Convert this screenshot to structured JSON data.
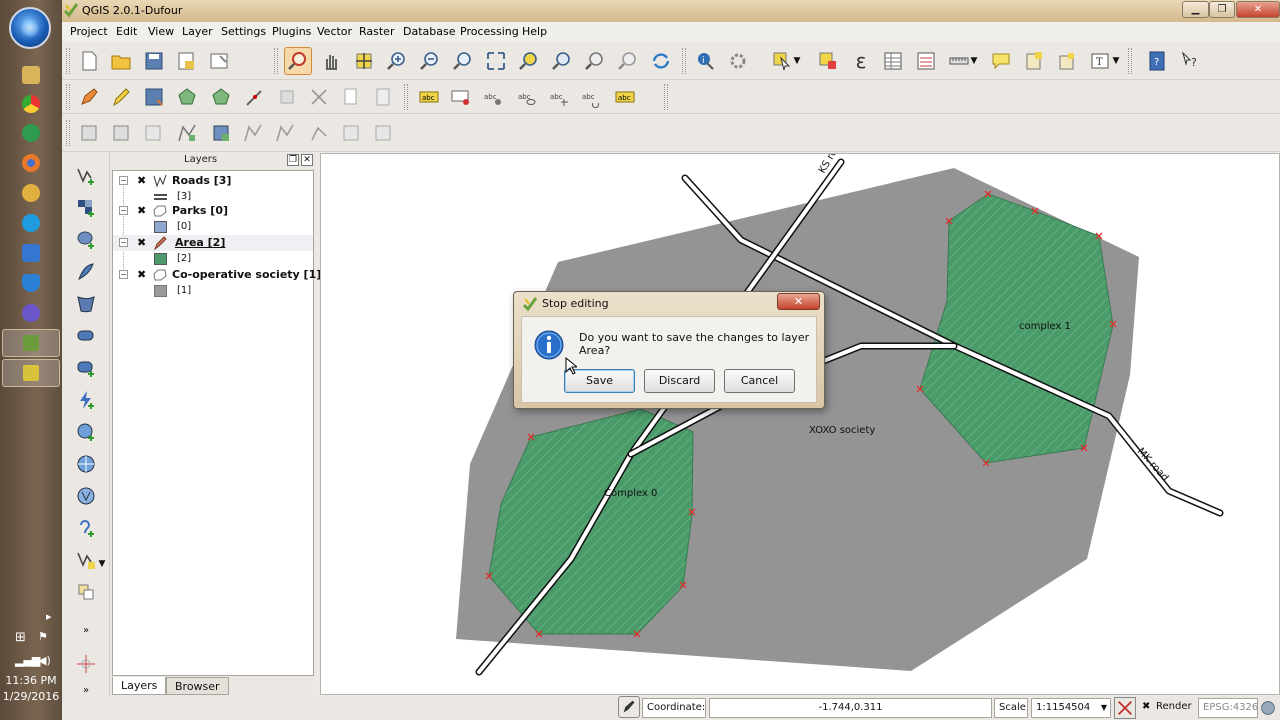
{
  "window": {
    "title": "QGIS 2.0.1-Dufour",
    "controls": [
      "minimize-icon",
      "restore-icon",
      "close-icon"
    ]
  },
  "menu": [
    "Project",
    "Edit",
    "View",
    "Layer",
    "Settings",
    "Plugins",
    "Vector",
    "Raster",
    "Database",
    "Processing",
    "Help"
  ],
  "layers_panel": {
    "title": "Layers",
    "layers": [
      {
        "name": "Roads [3]",
        "legend": "[3]",
        "icon": "line-layer-icon",
        "symbol": "line-symbol"
      },
      {
        "name": "Parks [0]",
        "legend": "[0]",
        "icon": "polygon-layer-icon",
        "symbol_color": "#8fa6cf"
      },
      {
        "name": "Area [2]",
        "legend": "[2]",
        "icon": "editing-pencil-icon",
        "symbol_color": "#4d9a6c",
        "selected": true
      },
      {
        "name": "Co-operative society [1]",
        "legend": "[1]",
        "icon": "polygon-layer-icon",
        "symbol_color": "#9a9a9a"
      }
    ],
    "tabs": [
      "Layers",
      "Browser"
    ]
  },
  "map": {
    "labels": {
      "ks_road": "KS road",
      "mk_road": "MK road",
      "complex_1": "complex 1",
      "complex_0": "Complex 0",
      "xoxo": "XOXO society"
    },
    "colors": {
      "society": "#949494",
      "area": "#4a9a6a",
      "road": "#ffffff",
      "vertex": "#e03030"
    }
  },
  "dialog": {
    "title": "Stop editing",
    "message": "Do you want to save the changes to layer Area?",
    "buttons": {
      "save": "Save",
      "discard": "Discard",
      "cancel": "Cancel"
    },
    "close": "✕"
  },
  "statusbar": {
    "coordinate_label": "Coordinate:",
    "coordinate_value": "-1.744,0.311",
    "scale_label": "Scale",
    "scale_value": "1:1154504",
    "render_label": "Render",
    "crs": "EPSG:4326"
  },
  "taskbar": {
    "time": "11:36 PM",
    "date": "1/29/2016"
  }
}
